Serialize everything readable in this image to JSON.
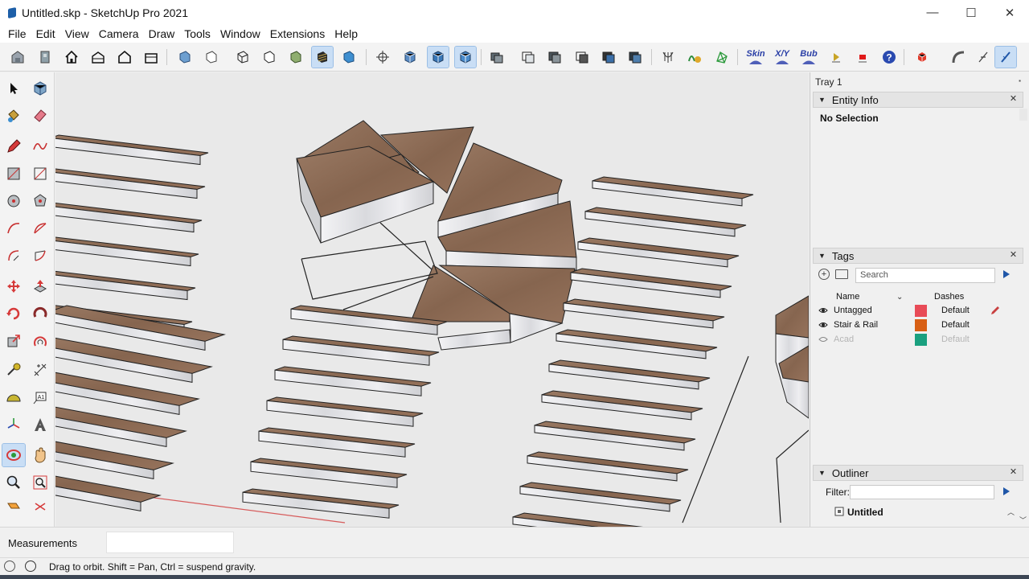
{
  "window": {
    "title": "Untitled.skp - SketchUp Pro 2021",
    "minimize": "—",
    "maximize": "☐",
    "close": "✕"
  },
  "menu": [
    "File",
    "Edit",
    "View",
    "Camera",
    "Draw",
    "Tools",
    "Window",
    "Extensions",
    "Help"
  ],
  "toolbar": {
    "skin_label": "Skin",
    "xy_label": "X/Y",
    "bub_label": "Bub"
  },
  "tray": {
    "title": "Tray 1",
    "entity_info": {
      "title": "Entity Info",
      "selection": "No Selection"
    },
    "tags": {
      "title": "Tags",
      "search_placeholder": "Search",
      "col_name": "Name",
      "col_dashes": "Dashes",
      "rows": [
        {
          "name": "Untagged",
          "color": "#e84b57",
          "dashes": "Default"
        },
        {
          "name": "Stair & Rail",
          "color": "#d85f14",
          "dashes": "Default"
        },
        {
          "name": "Acad",
          "color": "#1aa07f",
          "dashes": "Default"
        }
      ]
    },
    "outliner": {
      "title": "Outliner",
      "filter_label": "Filter:",
      "root": "Untitled"
    }
  },
  "measurements": {
    "label": "Measurements",
    "value": ""
  },
  "status": {
    "text": "Drag to orbit. Shift = Pan, Ctrl = suspend gravity."
  },
  "colors": {
    "tread": "#8a6a55",
    "riser": "#e6e6ea",
    "active_tool": "#c9def5"
  }
}
